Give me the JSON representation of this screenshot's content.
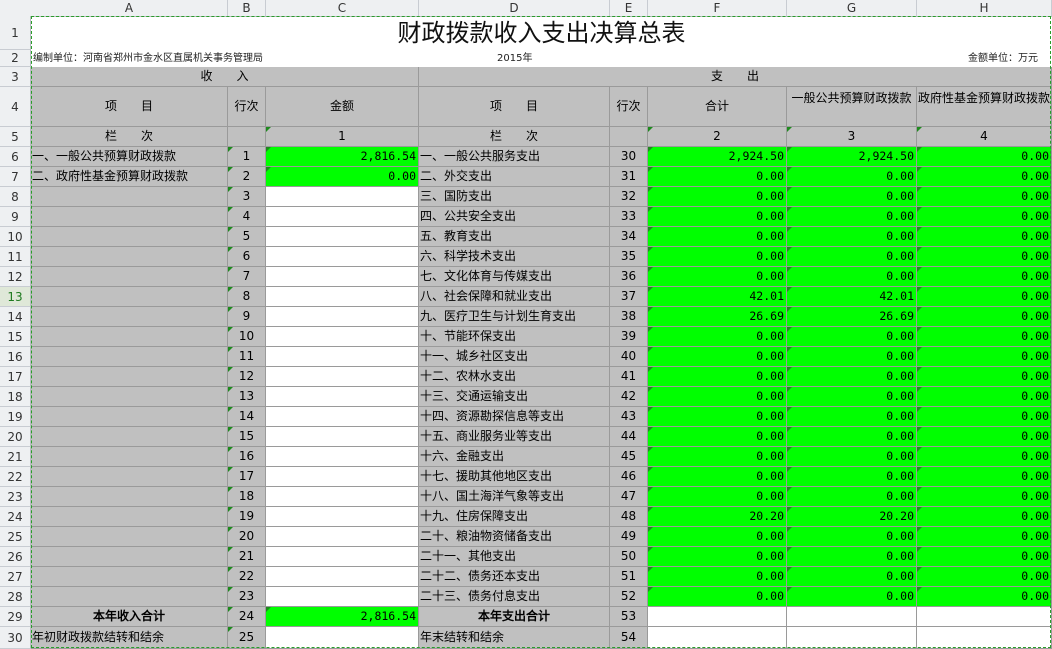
{
  "columns": [
    "A",
    "B",
    "C",
    "D",
    "E",
    "F",
    "G",
    "H"
  ],
  "rows": [
    "1",
    "2",
    "3",
    "4",
    "5",
    "6",
    "7",
    "8",
    "9",
    "10",
    "11",
    "12",
    "13",
    "14",
    "15",
    "16",
    "17",
    "18",
    "19",
    "20",
    "21",
    "22",
    "23",
    "24",
    "25",
    "26",
    "27",
    "28",
    "29",
    "30"
  ],
  "selected_row": "13",
  "title": "财政拨款收入支出决算总表",
  "unit_left": "编制单位：河南省郑州市金水区直属机关事务管理局",
  "year": "2015年",
  "unit_right": "金额单位：万元",
  "income_header": "收　　入",
  "expense_header": "支　　出",
  "hdr": {
    "item": "项　　目",
    "line": "行次",
    "amount": "金额",
    "item2": "项　　目",
    "line2": "行次",
    "total": "合计",
    "general": "一般公共预算财政拨款",
    "fund": "政府性基金预算财政拨款"
  },
  "colnum": {
    "label": "栏　　次",
    "c": "1",
    "label2": "栏　　次",
    "f": "2",
    "g": "3",
    "h": "4"
  },
  "body": [
    {
      "a": "一、一般公共预算财政拨款",
      "b": "1",
      "c": "2,816.54",
      "d": "一、一般公共服务支出",
      "e": "30",
      "f": "2,924.50",
      "g": "2,924.50",
      "h": "0.00"
    },
    {
      "a": "二、政府性基金预算财政拨款",
      "b": "2",
      "c": "0.00",
      "d": "二、外交支出",
      "e": "31",
      "f": "0.00",
      "g": "0.00",
      "h": "0.00"
    },
    {
      "a": "",
      "b": "3",
      "c": "",
      "d": "三、国防支出",
      "e": "32",
      "f": "0.00",
      "g": "0.00",
      "h": "0.00"
    },
    {
      "a": "",
      "b": "4",
      "c": "",
      "d": "四、公共安全支出",
      "e": "33",
      "f": "0.00",
      "g": "0.00",
      "h": "0.00"
    },
    {
      "a": "",
      "b": "5",
      "c": "",
      "d": "五、教育支出",
      "e": "34",
      "f": "0.00",
      "g": "0.00",
      "h": "0.00"
    },
    {
      "a": "",
      "b": "6",
      "c": "",
      "d": "六、科学技术支出",
      "e": "35",
      "f": "0.00",
      "g": "0.00",
      "h": "0.00"
    },
    {
      "a": "",
      "b": "7",
      "c": "",
      "d": "七、文化体育与传媒支出",
      "e": "36",
      "f": "0.00",
      "g": "0.00",
      "h": "0.00"
    },
    {
      "a": "",
      "b": "8",
      "c": "",
      "d": "八、社会保障和就业支出",
      "e": "37",
      "f": "42.01",
      "g": "42.01",
      "h": "0.00"
    },
    {
      "a": "",
      "b": "9",
      "c": "",
      "d": "九、医疗卫生与计划生育支出",
      "e": "38",
      "f": "26.69",
      "g": "26.69",
      "h": "0.00"
    },
    {
      "a": "",
      "b": "10",
      "c": "",
      "d": "十、节能环保支出",
      "e": "39",
      "f": "0.00",
      "g": "0.00",
      "h": "0.00"
    },
    {
      "a": "",
      "b": "11",
      "c": "",
      "d": "十一、城乡社区支出",
      "e": "40",
      "f": "0.00",
      "g": "0.00",
      "h": "0.00"
    },
    {
      "a": "",
      "b": "12",
      "c": "",
      "d": "十二、农林水支出",
      "e": "41",
      "f": "0.00",
      "g": "0.00",
      "h": "0.00"
    },
    {
      "a": "",
      "b": "13",
      "c": "",
      "d": "十三、交通运输支出",
      "e": "42",
      "f": "0.00",
      "g": "0.00",
      "h": "0.00"
    },
    {
      "a": "",
      "b": "14",
      "c": "",
      "d": "十四、资源勘探信息等支出",
      "e": "43",
      "f": "0.00",
      "g": "0.00",
      "h": "0.00"
    },
    {
      "a": "",
      "b": "15",
      "c": "",
      "d": "十五、商业服务业等支出",
      "e": "44",
      "f": "0.00",
      "g": "0.00",
      "h": "0.00"
    },
    {
      "a": "",
      "b": "16",
      "c": "",
      "d": "十六、金融支出",
      "e": "45",
      "f": "0.00",
      "g": "0.00",
      "h": "0.00"
    },
    {
      "a": "",
      "b": "17",
      "c": "",
      "d": "十七、援助其他地区支出",
      "e": "46",
      "f": "0.00",
      "g": "0.00",
      "h": "0.00"
    },
    {
      "a": "",
      "b": "18",
      "c": "",
      "d": "十八、国土海洋气象等支出",
      "e": "47",
      "f": "0.00",
      "g": "0.00",
      "h": "0.00"
    },
    {
      "a": "",
      "b": "19",
      "c": "",
      "d": "十九、住房保障支出",
      "e": "48",
      "f": "20.20",
      "g": "20.20",
      "h": "0.00"
    },
    {
      "a": "",
      "b": "20",
      "c": "",
      "d": "二十、粮油物资储备支出",
      "e": "49",
      "f": "0.00",
      "g": "0.00",
      "h": "0.00"
    },
    {
      "a": "",
      "b": "21",
      "c": "",
      "d": "二十一、其他支出",
      "e": "50",
      "f": "0.00",
      "g": "0.00",
      "h": "0.00"
    },
    {
      "a": "",
      "b": "22",
      "c": "",
      "d": "二十二、债务还本支出",
      "e": "51",
      "f": "0.00",
      "g": "0.00",
      "h": "0.00"
    },
    {
      "a": "",
      "b": "23",
      "c": "",
      "d": "二十三、债务付息支出",
      "e": "52",
      "f": "0.00",
      "g": "0.00",
      "h": "0.00"
    }
  ],
  "totals": {
    "a": "本年收入合计",
    "b": "24",
    "c": "2,816.54",
    "d": "本年支出合计",
    "e": "53"
  },
  "carry": {
    "a": "年初财政拨款结转和结余",
    "b": "25",
    "d": "年末结转和结余",
    "e": "54"
  }
}
